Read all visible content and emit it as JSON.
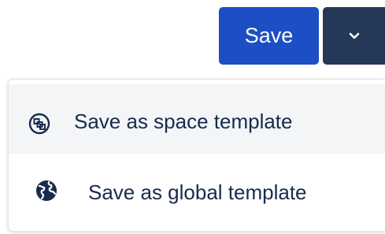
{
  "toolbar": {
    "save_label": "Save",
    "more_icon": "chevron-down-icon"
  },
  "menu": {
    "items": [
      {
        "label": "Save as space template",
        "icon": "space-template-icon",
        "highlighted": true
      },
      {
        "label": "Save as global template",
        "icon": "globe-icon",
        "highlighted": false
      }
    ]
  },
  "colors": {
    "save_button": "#1d4fc4",
    "more_button": "#253858",
    "text": "#172b4d",
    "hover_bg": "#f4f5f7"
  }
}
